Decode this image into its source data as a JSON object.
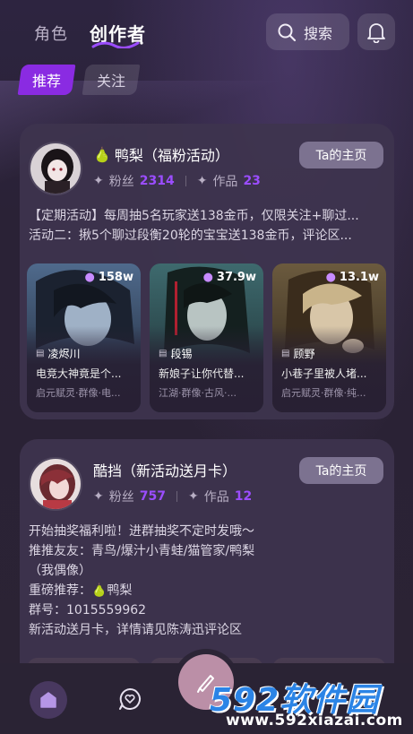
{
  "header": {
    "tabs": [
      "角色",
      "创作者"
    ],
    "search_label": "搜索"
  },
  "subtabs": [
    "推荐",
    "关注"
  ],
  "creators": [
    {
      "emoji": "🍐",
      "name": "鸭梨（福粉活动）",
      "fans_label": "粉丝",
      "fans": "2314",
      "works_label": "作品",
      "works": "23",
      "homepage_label": "Ta的主页",
      "desc_lines": [
        "【定期活动】每周抽5名玩家送138金币，仅限关注+聊过...",
        "活动二：揪5个聊过段衡20轮的宝宝送138金币，评论区..."
      ],
      "works_list": [
        {
          "heat": "158w",
          "name": "凌烬川",
          "desc": "电竞大神竟是个...",
          "tags": "启元赋灵·群像·电..."
        },
        {
          "heat": "37.9w",
          "name": "段锡",
          "desc": "新娘子让你代替...",
          "tags": "江湖·群像·古风·..."
        },
        {
          "heat": "13.1w",
          "name": "顾野",
          "desc": "小巷子里被人堵...",
          "tags": "启元赋灵·群像·纯..."
        }
      ]
    },
    {
      "name": "酷挡（新活动送月卡）",
      "fans_label": "粉丝",
      "fans": "757",
      "works_label": "作品",
      "works": "12",
      "homepage_label": "Ta的主页",
      "desc_lines": [
        "开始抽奖福利啦！进群抽奖不定时发哦～",
        "推推友友：青鸟/爆汁小青蛙/猫管家/鸭梨",
        "（我偶像）",
        "重磅推荐：🍐鸭梨",
        "群号：1015559962",
        "新活动送月卡，详情请见陈涛迅评论区"
      ]
    }
  ],
  "watermark": {
    "top": "592软件园",
    "bottom": "www.592xiazai.com"
  },
  "colors": {
    "accent": "#8a2be2",
    "number": "#9b4dff",
    "background": "#2a2236",
    "card": "#3e344e"
  }
}
